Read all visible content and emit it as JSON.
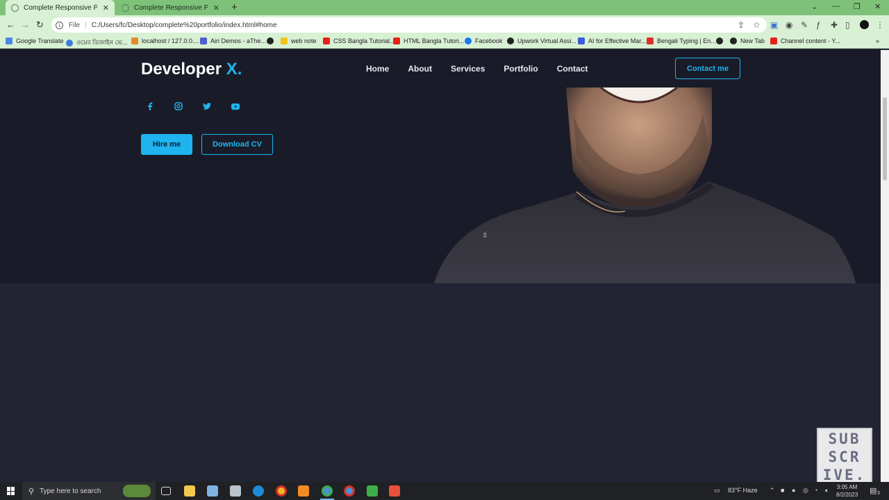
{
  "browser": {
    "tabs": [
      {
        "title": "Complete Responsive Personal P",
        "active": true
      },
      {
        "title": "Complete Responsive Personal P",
        "active": false
      }
    ],
    "new_tab": "+",
    "address_prefix": "File",
    "url": "C:/Users/fc/Desktop/complete%20portfolio/index.html#home",
    "bookmarks": [
      "Google Translate",
      "ওয়েব ডিজাইন ভে...",
      "localhost / 127.0.0....",
      "Airi Demos - aThe...",
      "web note",
      "CSS Bangla Tutorial...",
      "HTML Bangla Tutori...",
      "Facebook",
      "Upwork Virtual Assi...",
      "AI for Effective Mar...",
      "Bengali Typing | En...",
      "New Tab",
      "Channel content - Y..."
    ]
  },
  "site": {
    "logo_text": "Developer ",
    "logo_accent": "X.",
    "nav": [
      "Home",
      "About",
      "Services",
      "Portfolio",
      "Contact"
    ],
    "contact_button": "Contact me",
    "hire_button": "Hire me",
    "cv_button": "Download CV",
    "social_icons": [
      "facebook-icon",
      "instagram-icon",
      "twitter-icon",
      "youtube-icon"
    ],
    "accent_color": "#1fb4ef",
    "hero_bg": "#191c28",
    "section_bg": "#222433"
  },
  "overlay": {
    "subscribe_lines": [
      "SUB",
      "SCR",
      "IVE."
    ]
  },
  "taskbar": {
    "search_placeholder": "Type here to search",
    "weather": "83°F  Haze",
    "time": "3:05 AM",
    "date": "8/2/2023",
    "notification_count": "3"
  }
}
